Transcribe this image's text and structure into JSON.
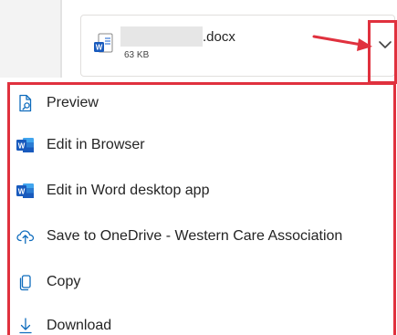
{
  "attachment": {
    "file_extension": ".docx",
    "file_size": "63 KB",
    "file_icon": "word-document-icon"
  },
  "dropdown": {
    "toggle_icon": "chevron-down-icon"
  },
  "menu": {
    "items": [
      {
        "label": "Preview",
        "icon": "preview-icon"
      },
      {
        "label": "Edit in Browser",
        "icon": "word-icon"
      },
      {
        "label": "Edit in Word desktop app",
        "icon": "word-icon"
      },
      {
        "label": "Save to OneDrive - Western Care Association",
        "icon": "cloud-upload-icon"
      },
      {
        "label": "Copy",
        "icon": "copy-icon"
      },
      {
        "label": "Download",
        "icon": "download-icon"
      }
    ]
  },
  "colors": {
    "annotation_red": "#e0313e",
    "word_blue": "#185abd",
    "icon_blue": "#0f6cbd"
  }
}
